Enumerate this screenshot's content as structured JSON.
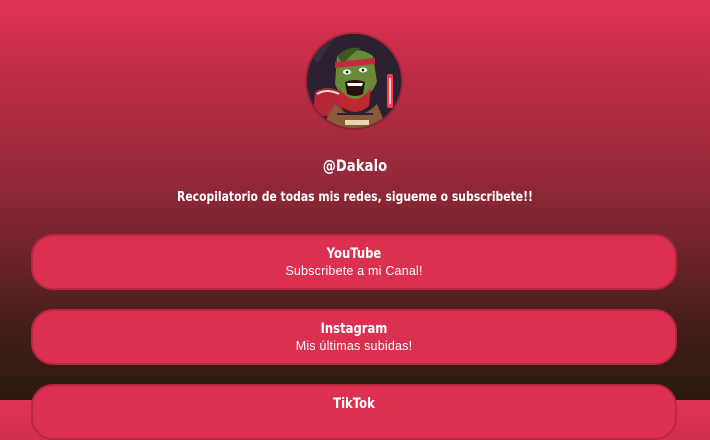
{
  "theme": {
    "accent": "#dc3050",
    "border": "#b82642",
    "text": "#ffffff"
  },
  "profile": {
    "handle": "@Dakalo",
    "bio": "Recopilatorio de todas mis redes, sigueme o subscribete!!",
    "avatar_icon": "illustrated-warrior-avatar"
  },
  "links": [
    {
      "title": "YouTube",
      "subtitle": "Subscribete a mi Canal!"
    },
    {
      "title": "Instagram",
      "subtitle": "Mis últimas subidas!"
    },
    {
      "title": "TikTok",
      "subtitle": ""
    }
  ]
}
